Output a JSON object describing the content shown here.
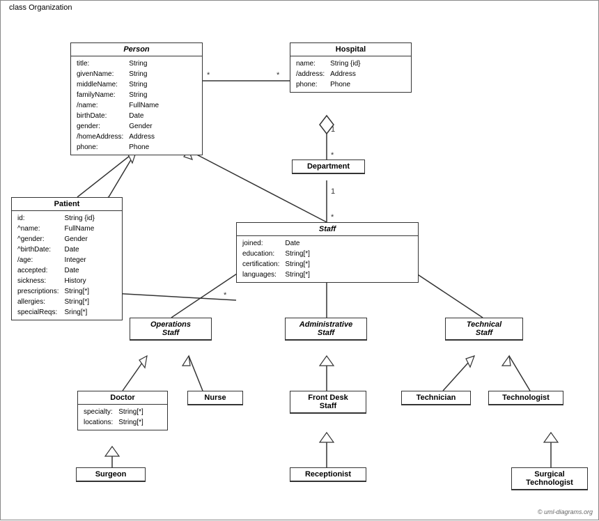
{
  "diagram": {
    "title": "class Organization",
    "copyright": "© uml-diagrams.org",
    "classes": {
      "person": {
        "name": "Person",
        "italic": true,
        "attributes": [
          [
            "title:",
            "String"
          ],
          [
            "givenName:",
            "String"
          ],
          [
            "middleName:",
            "String"
          ],
          [
            "familyName:",
            "String"
          ],
          [
            "/name:",
            "FullName"
          ],
          [
            "birthDate:",
            "Date"
          ],
          [
            "gender:",
            "Gender"
          ],
          [
            "/homeAddress:",
            "Address"
          ],
          [
            "phone:",
            "Phone"
          ]
        ]
      },
      "hospital": {
        "name": "Hospital",
        "italic": false,
        "attributes": [
          [
            "name:",
            "String {id}"
          ],
          [
            "/address:",
            "Address"
          ],
          [
            "phone:",
            "Phone"
          ]
        ]
      },
      "patient": {
        "name": "Patient",
        "italic": false,
        "attributes": [
          [
            "id:",
            "String {id}"
          ],
          [
            "^name:",
            "FullName"
          ],
          [
            "^gender:",
            "Gender"
          ],
          [
            "^birthDate:",
            "Date"
          ],
          [
            "/age:",
            "Integer"
          ],
          [
            "accepted:",
            "Date"
          ],
          [
            "sickness:",
            "History"
          ],
          [
            "prescriptions:",
            "String[*]"
          ],
          [
            "allergies:",
            "String[*]"
          ],
          [
            "specialReqs:",
            "Sring[*]"
          ]
        ]
      },
      "department": {
        "name": "Department",
        "italic": false,
        "attributes": []
      },
      "staff": {
        "name": "Staff",
        "italic": true,
        "attributes": [
          [
            "joined:",
            "Date"
          ],
          [
            "education:",
            "String[*]"
          ],
          [
            "certification:",
            "String[*]"
          ],
          [
            "languages:",
            "String[*]"
          ]
        ]
      },
      "operations_staff": {
        "name": "Operations Staff",
        "italic": true,
        "attributes": []
      },
      "administrative_staff": {
        "name": "Administrative Staff",
        "italic": true,
        "attributes": []
      },
      "technical_staff": {
        "name": "Technical Staff",
        "italic": true,
        "attributes": []
      },
      "doctor": {
        "name": "Doctor",
        "italic": false,
        "attributes": [
          [
            "specialty:",
            "String[*]"
          ],
          [
            "locations:",
            "String[*]"
          ]
        ]
      },
      "nurse": {
        "name": "Nurse",
        "italic": false,
        "attributes": []
      },
      "front_desk_staff": {
        "name": "Front Desk Staff",
        "italic": false,
        "attributes": []
      },
      "technician": {
        "name": "Technician",
        "italic": false,
        "attributes": []
      },
      "technologist": {
        "name": "Technologist",
        "italic": false,
        "attributes": []
      },
      "surgeon": {
        "name": "Surgeon",
        "italic": false,
        "attributes": []
      },
      "receptionist": {
        "name": "Receptionist",
        "italic": false,
        "attributes": []
      },
      "surgical_technologist": {
        "name": "Surgical Technologist",
        "italic": false,
        "attributes": []
      }
    }
  }
}
